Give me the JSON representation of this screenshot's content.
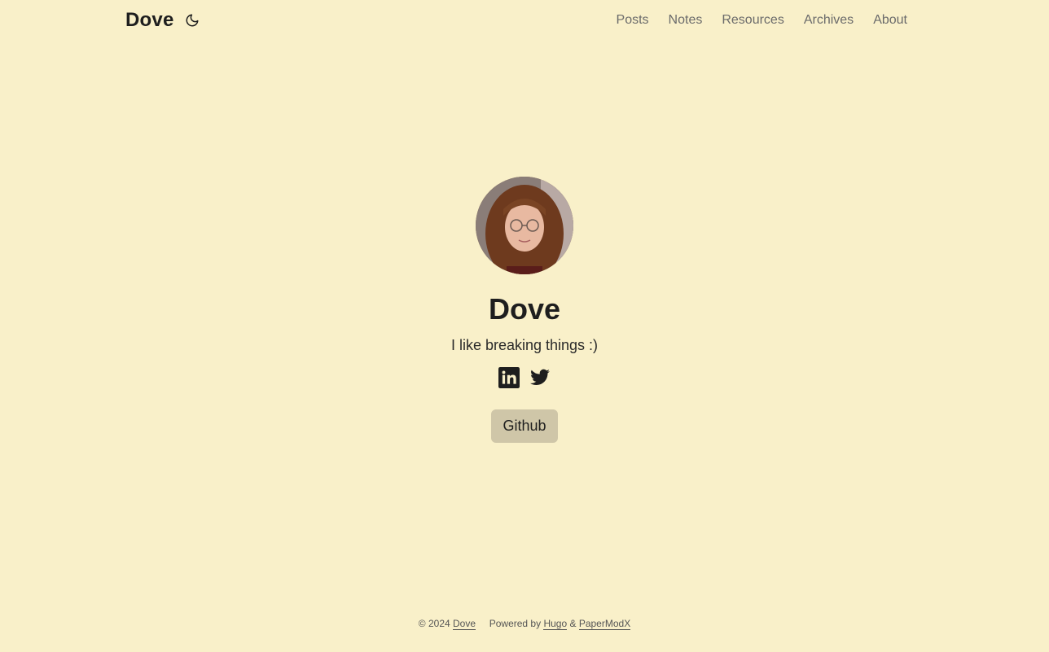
{
  "header": {
    "logo": "Dove",
    "theme_toggle_icon": "moon-icon",
    "nav": [
      "Posts",
      "Notes",
      "Resources",
      "Archives",
      "About"
    ]
  },
  "profile": {
    "name": "Dove",
    "bio": "I like breaking things :)",
    "socials": [
      "linkedin-icon",
      "twitter-icon"
    ],
    "button": "Github"
  },
  "footer": {
    "copyright": "© 2024",
    "copyright_link": "Dove",
    "powered_by": "Powered by",
    "hugo": "Hugo",
    "amp": "&",
    "papermod": "PaperModX"
  },
  "colors": {
    "background": "#f9f0c9",
    "text": "#1e1e1e",
    "nav": "#6b6b6b",
    "button_bg": "#cfc6a8"
  }
}
